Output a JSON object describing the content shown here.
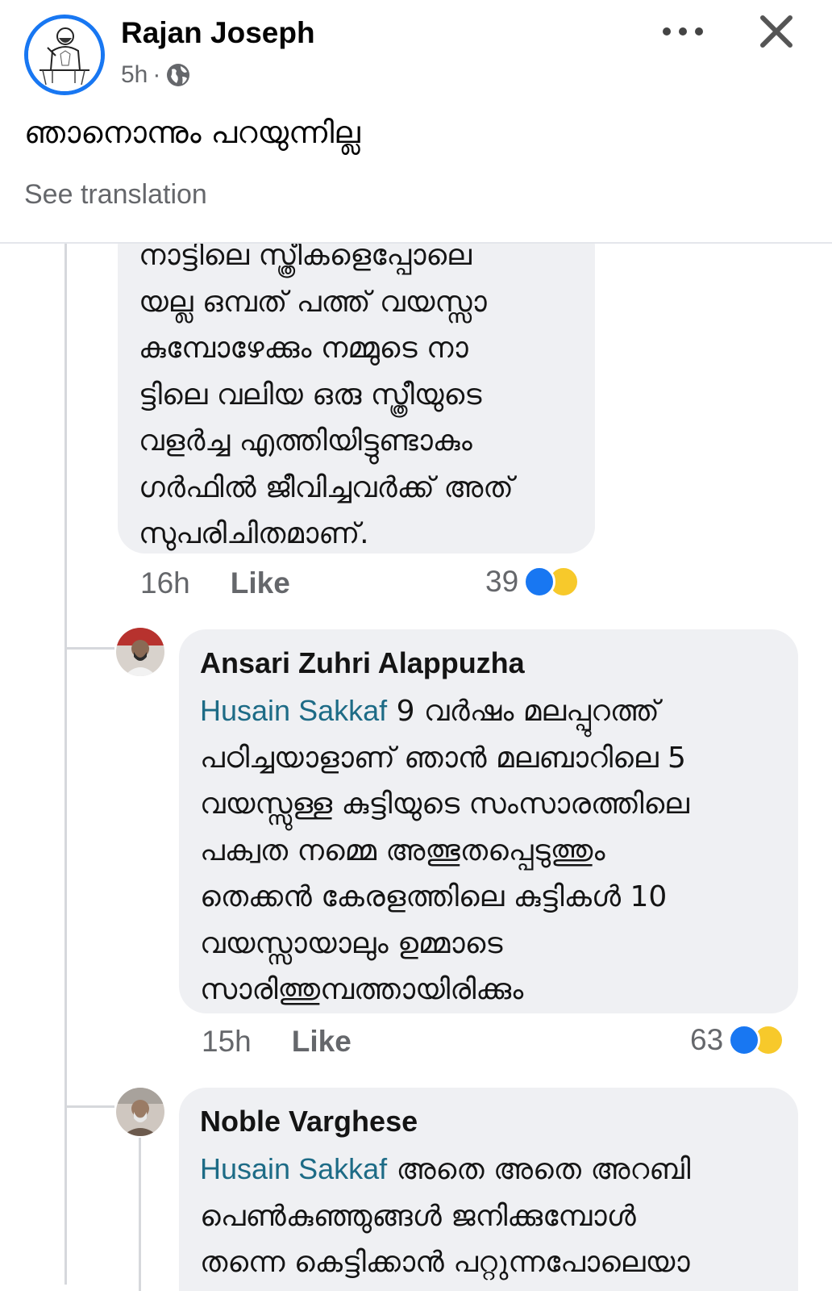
{
  "post": {
    "author": "Rajan Joseph",
    "time": "5h",
    "separator": "·",
    "privacy_icon": "globe-icon",
    "text": "ഞാനൊന്നും പറയുന്നില്ല",
    "see_translation": "See translation"
  },
  "comments": [
    {
      "lines": [
        "നാട്ടിലെ സ്ത്രീകളെപ്പോലെ",
        "യല്ല ഒമ്പത് പത്ത് വയസ്സാ",
        "കുമ്പോഴേക്കും നമ്മുടെ നാ",
        "ട്ടിലെ വലിയ ഒരു സ്ത്രീയുടെ",
        "വളർച്ച എത്തിയിട്ടുണ്ടാകും",
        "ഗർഫിൽ ജീവിച്ചവർക്ക് അത്",
        "സുപരിചിതമാണ്."
      ],
      "time": "16h",
      "like_label": "Like",
      "reaction_count": "39"
    },
    {
      "name": "Ansari Zuhri Alappuzha",
      "mention": "Husain Sakkaf",
      "first_line_rest": " 9 വർഷം മലപ്പുറത്ത്",
      "lines": [
        "പഠിച്ചയാളാണ് ഞാൻ  മലബാറിലെ 5",
        "വയസ്സുള്ള കുട്ടിയുടെ സംസാരത്തിലെ",
        "പക്വത നമ്മെ അത്ഭുതപ്പെടുത്തും",
        "തെക്കൻ കേരളത്തിലെ കുട്ടികൾ 10",
        "വയസ്സായാലും ഉമ്മാടെ",
        "സാരിത്തുമ്പത്തായിരിക്കും"
      ],
      "time": "15h",
      "like_label": "Like",
      "reaction_count": "63"
    },
    {
      "name": "Noble Varghese",
      "mention": "Husain Sakkaf",
      "first_line_rest": " അതെ അതെ അറബി",
      "lines": [
        "പെൺകുഞ്ഞുങ്ങൾ ജനിക്കുമ്പോൾ",
        "തന്നെ കെട്ടിക്കാൻ പറ്റുന്നപോലെയാ"
      ]
    }
  ],
  "colors": {
    "facebook_blue": "#1877f2",
    "bubble": "#eff0f3",
    "mention": "#1d6b86",
    "muted_text": "#65676b"
  }
}
